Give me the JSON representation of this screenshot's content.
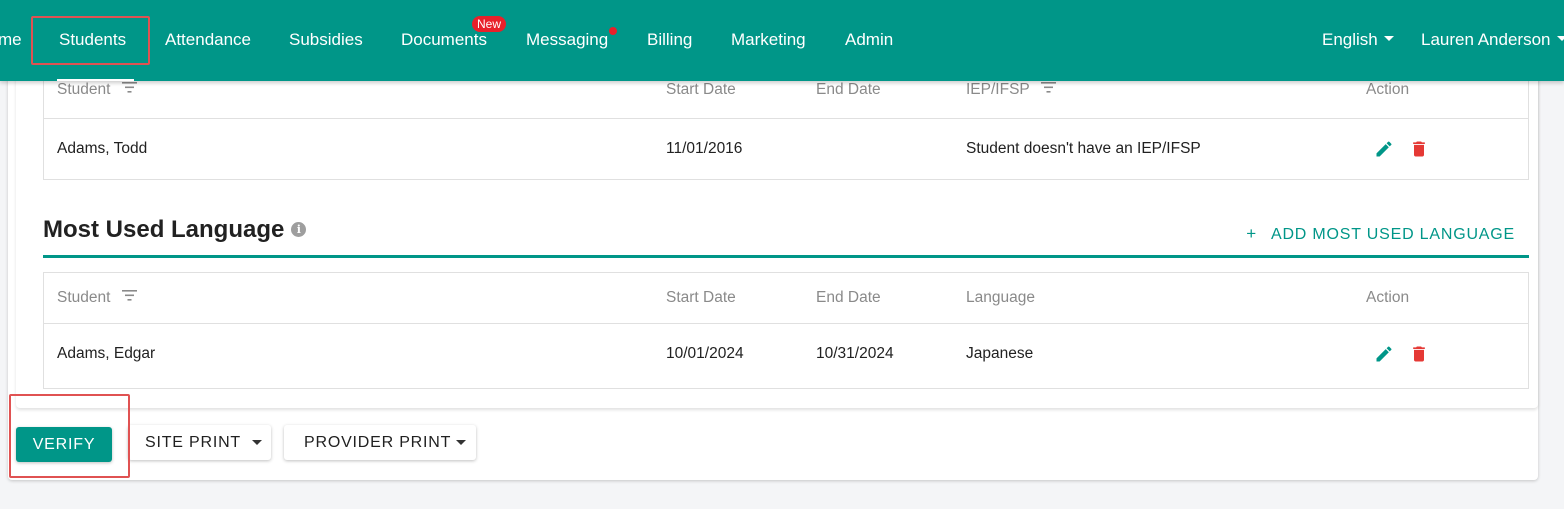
{
  "nav": {
    "items": [
      {
        "label": "me"
      },
      {
        "label": "Students"
      },
      {
        "label": "Attendance"
      },
      {
        "label": "Subsidies"
      },
      {
        "label": "Documents"
      },
      {
        "label": "Messaging"
      },
      {
        "label": "Billing"
      },
      {
        "label": "Marketing"
      },
      {
        "label": "Admin"
      }
    ],
    "active": "Students",
    "documents_badge": "New",
    "language": "English",
    "user": "Lauren Anderson"
  },
  "iep_table": {
    "headers": [
      "Student",
      "Start Date",
      "End Date",
      "IEP/IFSP",
      "Action"
    ],
    "rows": [
      {
        "student": "Adams, Todd",
        "start": "11/01/2016",
        "end": "",
        "value": "Student doesn't have an IEP/IFSP"
      }
    ]
  },
  "language_section": {
    "title": "Most Used Language",
    "add_label": "ADD MOST USED LANGUAGE",
    "add_symbol": "+",
    "headers": [
      "Student",
      "Start Date",
      "End Date",
      "Language",
      "Action"
    ],
    "rows": [
      {
        "student": "Adams, Edgar",
        "start": "10/01/2024",
        "end": "10/31/2024",
        "language": "Japanese"
      }
    ]
  },
  "buttons": {
    "verify": "VERIFY",
    "site_print": "SITE PRINT",
    "provider_print": "PROVIDER PRINT"
  },
  "colors": {
    "brand": "#009688",
    "delete": "#e53935",
    "highlight": "#e05252",
    "badge": "#e8202a"
  }
}
